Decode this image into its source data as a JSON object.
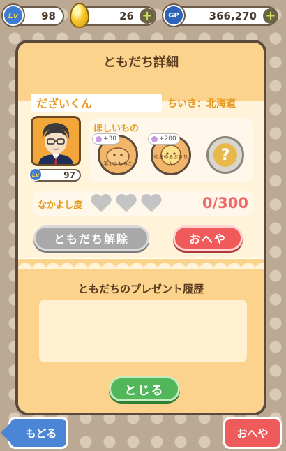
{
  "status": {
    "level_value": "98",
    "level_icon": "lv-badge-icon",
    "eggs_value": "26",
    "gp_label": "GP",
    "gp_value": "366,270",
    "plus": "+"
  },
  "dialog": {
    "title": "ともだち詳細",
    "friend_name": "だざいくん",
    "region": "ちいき：北海道",
    "friend_level": "97",
    "wishlist": {
      "title": "ほしいもの",
      "items": [
        {
          "reward": "+30",
          "caption": "湯ぶりもみこ"
        },
        {
          "reward": "+200",
          "caption": "ぬるぬるぷりりん"
        }
      ],
      "unknown": "?"
    },
    "friendship": {
      "label": "なかよし度",
      "score": "0/300",
      "hearts": 3,
      "filled": 0
    },
    "unfriend_button": "ともだち解除",
    "room_button": "おへや",
    "history_title": "ともだちのプレゼント履歴",
    "close_button": "とじる"
  },
  "nav": {
    "back": "もどる",
    "room": "おへや"
  },
  "colors": {
    "accent_orange": "#e69a1f",
    "panel_header": "#fbd38c",
    "score_red": "#ef6a6a",
    "button_red": "#f05a5a",
    "button_green": "#52b75a",
    "button_blue": "#4b86d6"
  }
}
